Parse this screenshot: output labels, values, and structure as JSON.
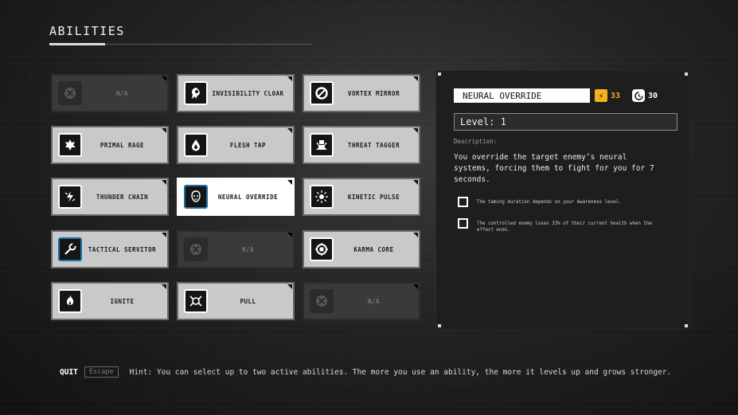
{
  "header": {
    "title": "ABILITIES"
  },
  "abilities": [
    {
      "label": "N/A",
      "icon": "empty-slot-icon",
      "state": "empty"
    },
    {
      "label": "INVISIBILITY CLOAK",
      "icon": "cloak-icon",
      "state": "normal"
    },
    {
      "label": "VORTEX MIRROR",
      "icon": "vortex-icon",
      "state": "normal"
    },
    {
      "label": "PRIMAL RAGE",
      "icon": "rage-icon",
      "state": "normal"
    },
    {
      "label": "FLESH TAP",
      "icon": "drop-icon",
      "state": "normal"
    },
    {
      "label": "THREAT TAGGER",
      "icon": "tagger-icon",
      "state": "normal"
    },
    {
      "label": "THUNDER CHAIN",
      "icon": "lightning-icon",
      "state": "normal"
    },
    {
      "label": "NEURAL OVERRIDE",
      "icon": "brain-head-icon",
      "state": "selected"
    },
    {
      "label": "KINETIC PULSE",
      "icon": "pulse-icon",
      "state": "normal"
    },
    {
      "label": "TACTICAL SERVITOR",
      "icon": "wrench-icon",
      "state": "normal"
    },
    {
      "label": "N/A",
      "icon": "empty-slot-icon",
      "state": "empty"
    },
    {
      "label": "KARMA CORE",
      "icon": "core-icon",
      "state": "normal"
    },
    {
      "label": "IGNITE",
      "icon": "fire-icon",
      "state": "normal"
    },
    {
      "label": "PULL",
      "icon": "pull-icon",
      "state": "normal"
    },
    {
      "label": "N/A",
      "icon": "empty-slot-icon",
      "state": "empty"
    }
  ],
  "detail": {
    "name": "NEURAL OVERRIDE",
    "energy_cost": "33",
    "cooldown": "30",
    "level": "Level: 1",
    "description_label": "Description:",
    "description": "You override the target enemy’s neural systems, forcing them to fight for you for 7 seconds.",
    "modifiers": [
      "The taming duration depends on your Awareness level.",
      "The controlled enemy loses 33% of their current health when the effect ends."
    ]
  },
  "footer": {
    "quit_label": "QUIT",
    "quit_key": "Escape",
    "hint": "Hint: You can select up to two active abilities. The more you use an ability, the more it levels up and grows stronger."
  },
  "colors": {
    "accent_energy": "#f2b31c",
    "selected_border": "#1d6fa5"
  }
}
